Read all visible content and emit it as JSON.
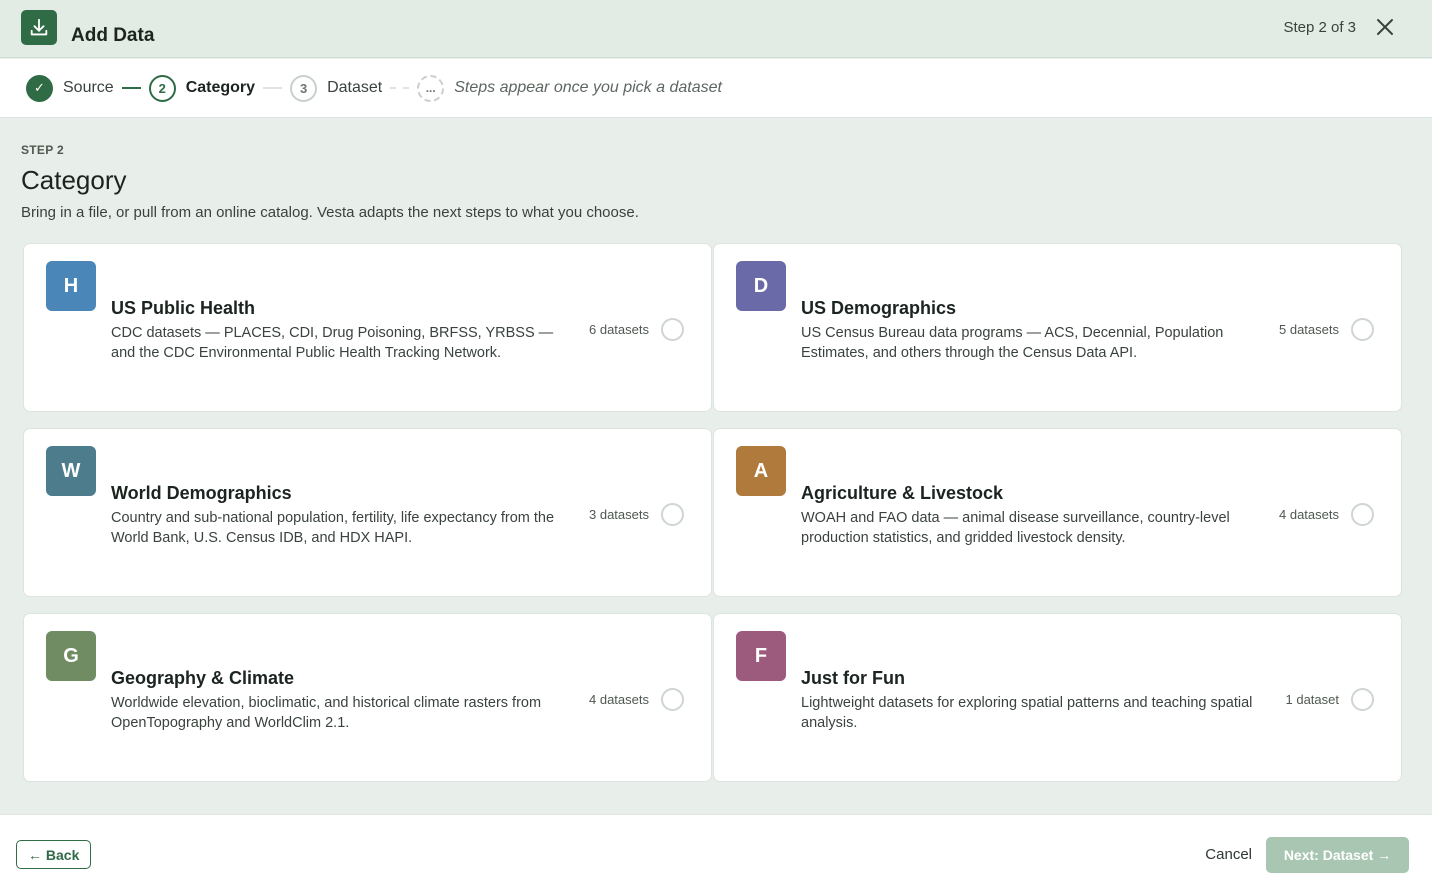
{
  "header": {
    "title": "Add Data",
    "step_count": "Step 2 of 3",
    "logo_icon": "download-tray-icon",
    "close_icon": "close-icon"
  },
  "stepper": {
    "steps": [
      {
        "label": "Source",
        "state": "done",
        "marker": "✓"
      },
      {
        "label": "Category",
        "state": "active",
        "marker": "2"
      },
      {
        "label": "Dataset",
        "state": "todo",
        "marker": "3"
      },
      {
        "label": "Steps appear once you pick a dataset",
        "state": "future",
        "marker": "..."
      }
    ]
  },
  "main": {
    "eyebrow": "STEP 2",
    "title": "Category",
    "lede": "Bring in a file, or pull from an online catalog. Vesta adapts the next steps to what you choose.",
    "categories": [
      {
        "letter": "H",
        "color": "#4a86b8",
        "title": "US Public Health",
        "description": "CDC datasets — PLACES, CDI, Drug Poisoning, BRFSS, YRBSS — and the CDC Environmental Public Health Tracking Network.",
        "count": "6 datasets"
      },
      {
        "letter": "D",
        "color": "#6b6aa8",
        "title": "US Demographics",
        "description": "US Census Bureau data programs — ACS, Decennial, Population Estimates, and others through the Census Data API.",
        "count": "5 datasets"
      },
      {
        "letter": "W",
        "color": "#4d7d8c",
        "title": "World Demographics",
        "description": "Country and sub-national population, fertility, life expectancy from the World Bank, U.S. Census IDB, and HDX HAPI.",
        "count": "3 datasets"
      },
      {
        "letter": "A",
        "color": "#b07a3d",
        "title": "Agriculture & Livestock",
        "description": "WOAH and FAO data — animal disease surveillance, country-level production statistics, and gridded livestock density.",
        "count": "4 datasets"
      },
      {
        "letter": "G",
        "color": "#6f8c62",
        "title": "Geography & Climate",
        "description": "Worldwide elevation, bioclimatic, and historical climate rasters from OpenTopography and WorldClim 2.1.",
        "count": "4 datasets"
      },
      {
        "letter": "F",
        "color": "#9c5a7c",
        "title": "Just for Fun",
        "description": "Lightweight datasets for exploring spatial patterns and teaching spatial analysis.",
        "count": "1 dataset"
      }
    ]
  },
  "footer": {
    "back_label": "← Back",
    "cancel_label": "Cancel",
    "next_label": "Next: Dataset →"
  },
  "colors": {
    "brand": "#2f6b45",
    "next_disabled": "#a9c6b2"
  }
}
